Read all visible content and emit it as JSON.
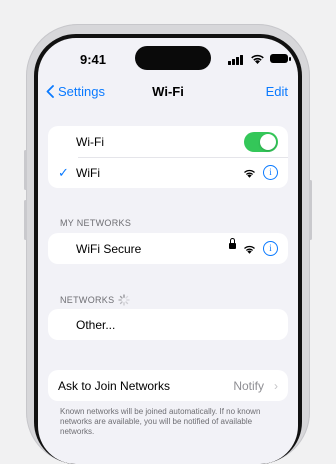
{
  "status": {
    "time": "9:41"
  },
  "nav": {
    "back_label": "Settings",
    "title": "Wi-Fi",
    "edit_label": "Edit"
  },
  "wifi_group": {
    "toggle_label": "Wi-Fi",
    "toggle_on": true,
    "current_network": "WiFi"
  },
  "my_networks": {
    "header": "MY NETWORKS",
    "items": [
      {
        "name": "WiFi Secure",
        "secured": true
      }
    ]
  },
  "networks": {
    "header": "NETWORKS",
    "other_label": "Other..."
  },
  "ask_join": {
    "label": "Ask to Join Networks",
    "value": "Notify",
    "footer": "Known networks will be joined automatically. If no known networks are available, you will be notified of available networks."
  },
  "colors": {
    "accent": "#0a7aff",
    "toggle_on": "#34c759"
  }
}
